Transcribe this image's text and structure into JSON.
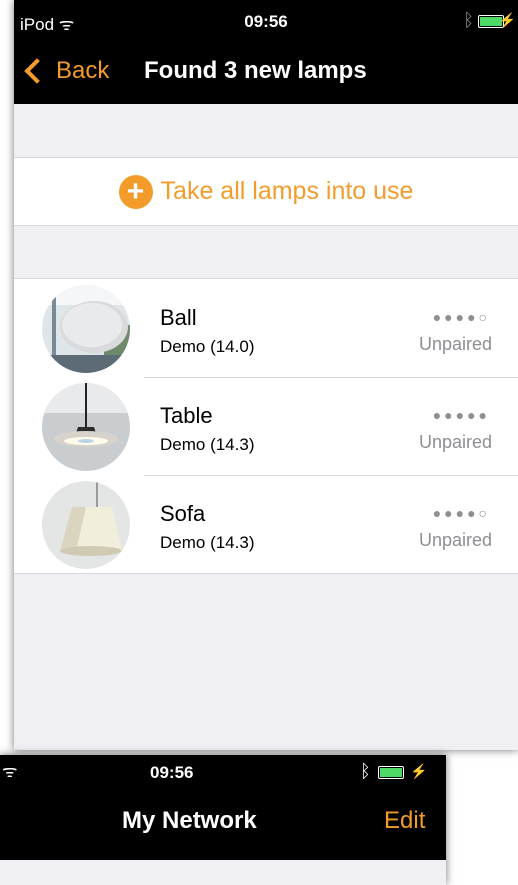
{
  "status_bar": {
    "carrier": "iPod",
    "time": "09:56"
  },
  "nav": {
    "back_label": "Back",
    "title": "Found 3 new lamps"
  },
  "action": {
    "label": "Take all lamps into use"
  },
  "lamps": [
    {
      "name": "Ball",
      "subtitle": "Demo (14.0)",
      "signal": "●●●●○",
      "status": "Unpaired"
    },
    {
      "name": "Table",
      "subtitle": "Demo (14.3)",
      "signal": "●●●●●",
      "status": "Unpaired"
    },
    {
      "name": "Sofa",
      "subtitle": "Demo (14.3)",
      "signal": "●●●●○",
      "status": "Unpaired"
    }
  ],
  "second_screen": {
    "time": "09:56",
    "title": "My Network",
    "edit_label": "Edit"
  },
  "colors": {
    "accent": "#f39c2c",
    "background": "#efeff4",
    "bar": "#000000",
    "battery": "#4cd964"
  }
}
